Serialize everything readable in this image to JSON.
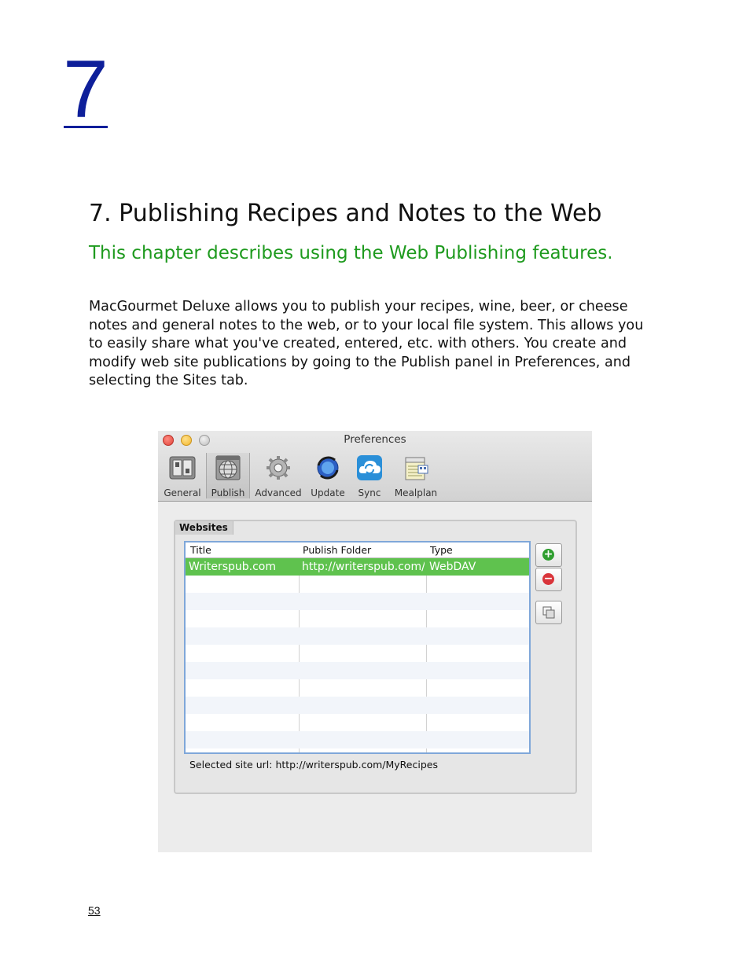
{
  "chapter": {
    "number": "7"
  },
  "title": "7. Publishing Recipes and Notes to the Web",
  "subtitle": "This chapter describes using the Web Publishing features.",
  "body_lines": [
    "MacGourmet Deluxe allows you to publish your recipes, wine, beer, or cheese",
    "notes and general notes to the web, or to your local file system. This allows you",
    "to easily share what you've created, entered, etc. with others. You create and",
    "modify web site publications by going to the Publish panel in Preferences, and",
    "selecting the Sites tab."
  ],
  "window": {
    "title": "Preferences",
    "toolbar": [
      {
        "label": "General",
        "icon": "switches-icon"
      },
      {
        "label": "Publish",
        "icon": "globe-icon",
        "selected": true
      },
      {
        "label": "Advanced",
        "icon": "gear-icon"
      },
      {
        "label": "Update",
        "icon": "update-icon"
      },
      {
        "label": "Sync",
        "icon": "sync-icon"
      },
      {
        "label": "Mealplan",
        "icon": "calendar-icon"
      }
    ],
    "group_tab": "Websites",
    "table": {
      "columns": [
        "Title",
        "Publish Folder",
        "Type"
      ],
      "rows": [
        {
          "title": "Writerspub.com",
          "folder": "http://writerspub.com/MyRecipes",
          "type": "WebDAV",
          "selected": true
        }
      ]
    },
    "buttons": {
      "add": "+",
      "remove": "−"
    },
    "status_label": "Selected site url:",
    "status_url": "http://writerspub.com/MyRecipes",
    "colors": {
      "selection": "#5fc24e",
      "add": "#2f9e2f",
      "remove": "#d9343a",
      "sync": "#2a8fd8"
    }
  },
  "page_number": "53"
}
